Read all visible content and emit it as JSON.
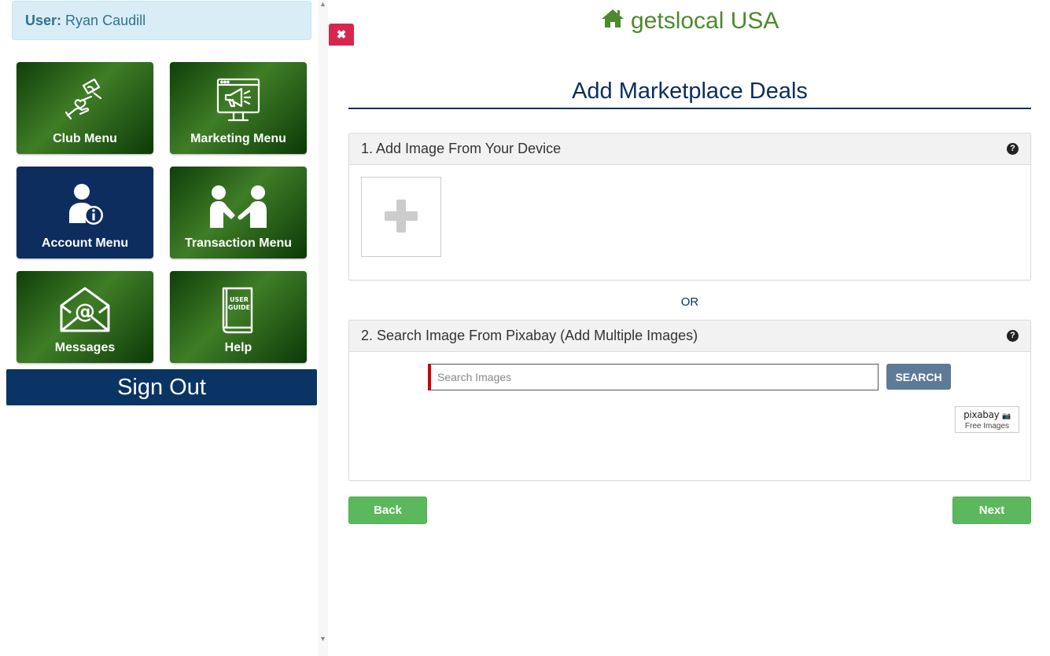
{
  "user": {
    "label": "User:",
    "name": "Ryan Caudill"
  },
  "menu": {
    "tiles": [
      {
        "label": "Club Menu",
        "icon": "heart-hands-icon"
      },
      {
        "label": "Marketing Menu",
        "icon": "megaphone-monitor-icon"
      },
      {
        "label": "Account Menu",
        "icon": "user-info-icon"
      },
      {
        "label": "Transaction Menu",
        "icon": "handshake-icon"
      },
      {
        "label": "Messages",
        "icon": "envelope-at-icon"
      },
      {
        "label": "Help",
        "icon": "user-guide-icon",
        "icon_text_1": "USER",
        "icon_text_2": "GUIDE"
      }
    ],
    "sign_out": "Sign Out"
  },
  "close_button": {
    "glyph": "✖"
  },
  "brand": {
    "name": "getslocal USA",
    "icon": "home-icon",
    "color": "#4c8a2d"
  },
  "page": {
    "title": "Add Marketplace Deals",
    "panel1": {
      "title": "1. Add Image From Your Device",
      "help": "?"
    },
    "or": "OR",
    "panel2": {
      "title": "2. Search Image From Pixabay (Add Multiple Images)",
      "help": "?",
      "search_placeholder": "Search Images",
      "search_value": "",
      "search_button": "SEARCH",
      "pixabay_logo": "pixabay",
      "pixabay_sub": "Free Images"
    },
    "back_button": "Back",
    "next_button": "Next"
  },
  "colors": {
    "navy": "#0b2e5b",
    "tile_green": "#3f7d26",
    "tile_blue": "#0d2d5e",
    "button_green": "#5cb85c",
    "close_red": "#d9264f",
    "search_button": "#5e7a99"
  }
}
